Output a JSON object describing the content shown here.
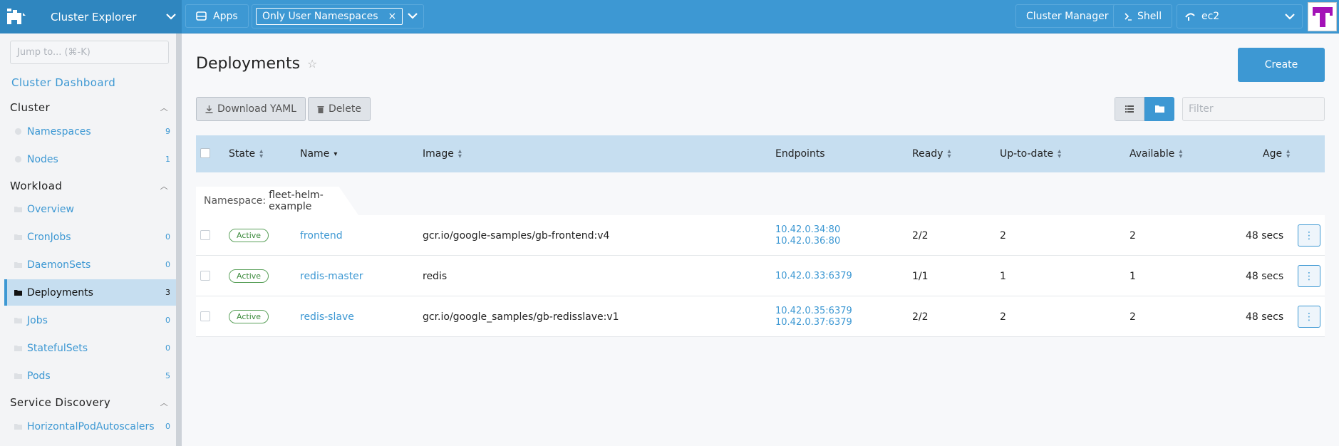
{
  "topbar": {
    "title": "Cluster Explorer",
    "apps_label": "Apps",
    "namespace_filter": "Only User Namespaces",
    "cluster_manager_label": "Cluster Manager",
    "shell_label": "Shell",
    "cluster_name": "ec2",
    "colors": {
      "bar": "#3d98d3",
      "brand": "#2f86bf",
      "avatar": "#a312b7"
    }
  },
  "sidebar": {
    "jump_placeholder": "Jump to... (⌘-K)",
    "dashboard_link": "Cluster Dashboard",
    "groups": [
      {
        "label": "Cluster",
        "items": [
          {
            "label": "Namespaces",
            "count": "9"
          },
          {
            "label": "Nodes",
            "count": "1"
          }
        ]
      },
      {
        "label": "Workload",
        "items": [
          {
            "label": "Overview",
            "count": ""
          },
          {
            "label": "CronJobs",
            "count": "0"
          },
          {
            "label": "DaemonSets",
            "count": "0"
          },
          {
            "label": "Deployments",
            "count": "3"
          },
          {
            "label": "Jobs",
            "count": "0"
          },
          {
            "label": "StatefulSets",
            "count": "0"
          },
          {
            "label": "Pods",
            "count": "5"
          }
        ]
      },
      {
        "label": "Service Discovery",
        "items": [
          {
            "label": "HorizontalPodAutoscalers",
            "count": "0"
          }
        ]
      }
    ]
  },
  "main": {
    "title": "Deployments",
    "create_label": "Create",
    "download_yaml_label": "Download YAML",
    "delete_label": "Delete",
    "filter_placeholder": "Filter",
    "columns": [
      "State",
      "Name",
      "Image",
      "Endpoints",
      "Ready",
      "Up-to-date",
      "Available",
      "Age"
    ],
    "namespace_key": "Namespace:",
    "namespace_value": "fleet-helm-example",
    "rows": [
      {
        "state": "Active",
        "name": "frontend",
        "image": "gcr.io/google-samples/gb-frontend:v4",
        "endpoint1": "10.42.0.34:80",
        "endpoint2": "10.42.0.36:80",
        "ready": "2/2",
        "uptodate": "2",
        "available": "2",
        "age": "48 secs"
      },
      {
        "state": "Active",
        "name": "redis-master",
        "image": "redis",
        "endpoint1": "10.42.0.33:6379",
        "endpoint2": "",
        "ready": "1/1",
        "uptodate": "1",
        "available": "1",
        "age": "48 secs"
      },
      {
        "state": "Active",
        "name": "redis-slave",
        "image": "gcr.io/google_samples/gb-redisslave:v1",
        "endpoint1": "10.42.0.35:6379",
        "endpoint2": "10.42.0.37:6379",
        "ready": "2/2",
        "uptodate": "2",
        "available": "2",
        "age": "48 secs"
      }
    ]
  }
}
